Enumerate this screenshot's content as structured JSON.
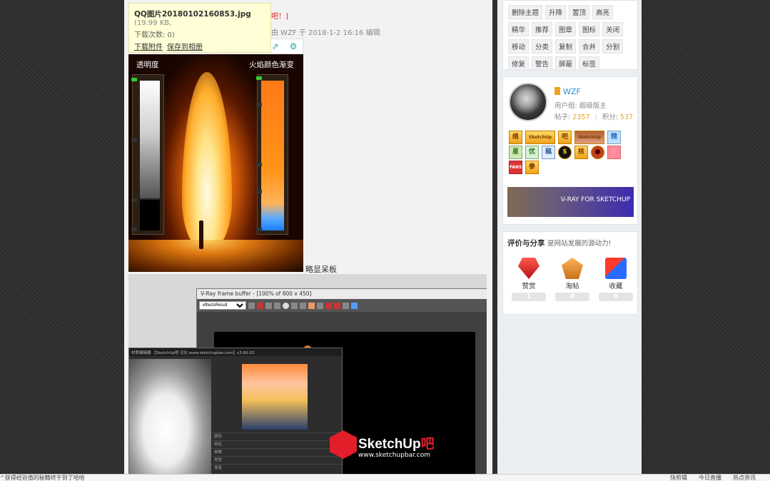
{
  "tooltip": {
    "filename": "QQ图片20180102160853.jpg",
    "filesize": "(19.99 KB,",
    "downloads": "下载次数: 0)",
    "download_link": "下载附件",
    "save_link": "保存到相册"
  },
  "post": {
    "red_mark": "吧！]",
    "edit_note": "由 WZF 于 2018-1-2 16:16 编辑"
  },
  "image_tools": {
    "icons": [
      "original-size-icon",
      "fullscreen-icon",
      "save-icon",
      "share-icon",
      "settings-icon"
    ]
  },
  "candle_image": {
    "left_label": "透明度",
    "right_label": "火焰颜色渐变"
  },
  "caption": "略显呆板",
  "vfb": {
    "title": "V-Ray frame buffer - [100% of 800 x 450]",
    "select": "effectsResult",
    "mat_title": "材质编辑器 【SketchUp吧 汉化 www.sketchupbar.com】v3.60.03",
    "rows": [
      "颜色",
      "特征",
      "参数",
      "类型",
      "渐变"
    ]
  },
  "watermark": {
    "brand_a": "SketchUp",
    "brand_b": "吧",
    "url": "www.sketchupbar.com"
  },
  "moderation": {
    "buttons": [
      "删除主题",
      "升降",
      "置顶",
      "高亮",
      "精华",
      "推荐",
      "图章",
      "图标",
      "关闭",
      "移动",
      "分类",
      "复制",
      "合并",
      "分割",
      "修复",
      "警告",
      "屏蔽",
      "标签"
    ]
  },
  "profile": {
    "username": "WZF",
    "group": "用户组: 超级版主",
    "posts_label": "帖子:",
    "posts": "2357",
    "sep": "|",
    "points_label": "积分:",
    "points": "537",
    "medals": [
      "维",
      "SketchUp",
      "吧",
      "SketchUp",
      "精",
      "星",
      "优",
      "稿",
      "$",
      "核",
      "●",
      "♡",
      "FANS",
      "拳"
    ],
    "banner": "V-RAY FOR SKETCHUP"
  },
  "share": {
    "title": "评价与分享",
    "subtitle": "是网站发展的源动力!",
    "actions": [
      {
        "label": "赞赏",
        "count": "1"
      },
      {
        "label": "淘帖",
        "count": "0"
      },
      {
        "label": "收藏",
        "count": "0"
      }
    ]
  },
  "footer": {
    "left": "^获得经验值的秘籍终于到了哈哈",
    "right": [
      "快剪辑",
      "今日直播",
      "热点资讯"
    ]
  }
}
